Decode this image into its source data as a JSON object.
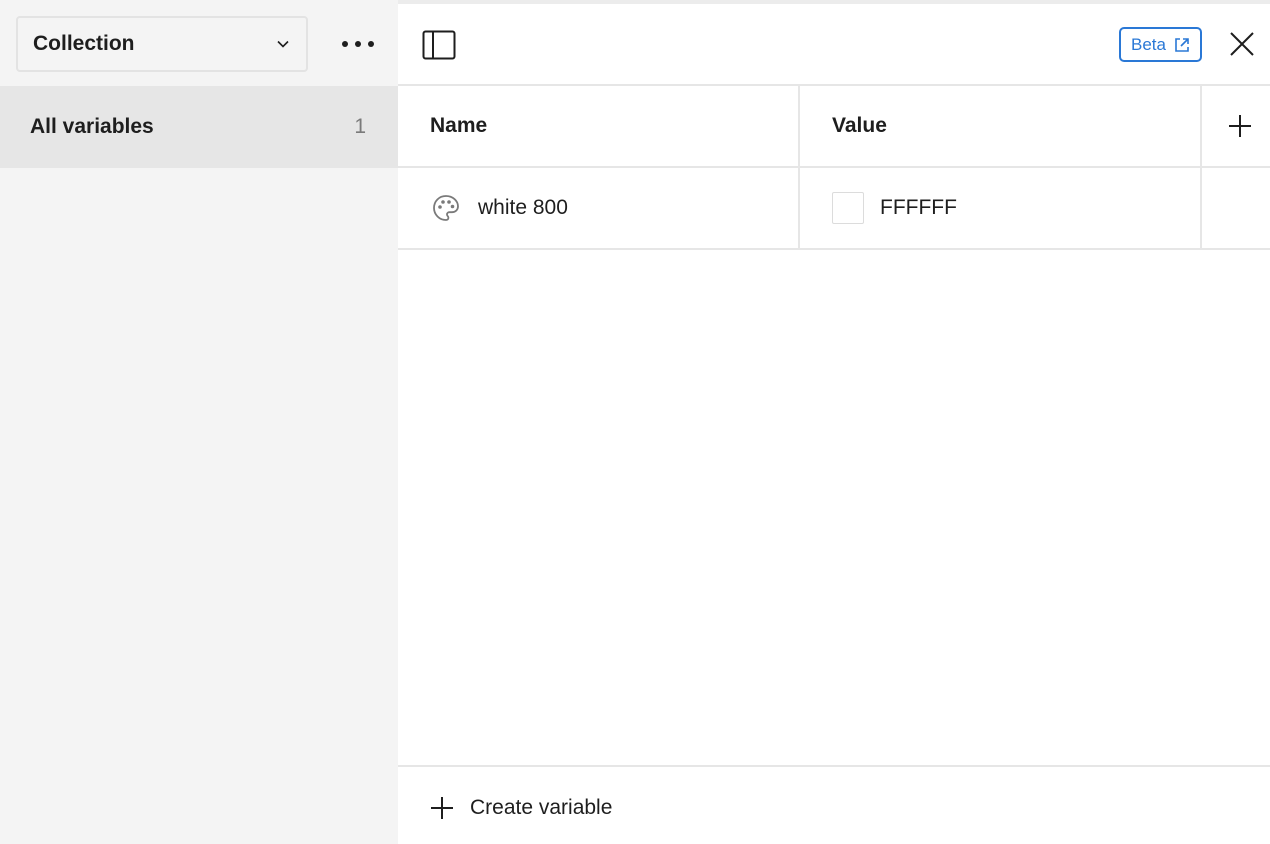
{
  "sidebar": {
    "collection_label": "Collection",
    "items": [
      {
        "label": "All variables",
        "count": "1"
      }
    ]
  },
  "toolbar": {
    "beta_label": "Beta"
  },
  "table": {
    "columns": [
      "Name",
      "Value"
    ],
    "rows": [
      {
        "name": "white 800",
        "value": "FFFFFF",
        "swatch_color": "#FFFFFF",
        "icon": "palette-icon"
      }
    ]
  },
  "footer": {
    "create_label": "Create variable"
  },
  "colors": {
    "accent": "#2A78D6",
    "sidebar_bg": "#F4F4F4",
    "selected_bg": "#E6E6E6"
  }
}
